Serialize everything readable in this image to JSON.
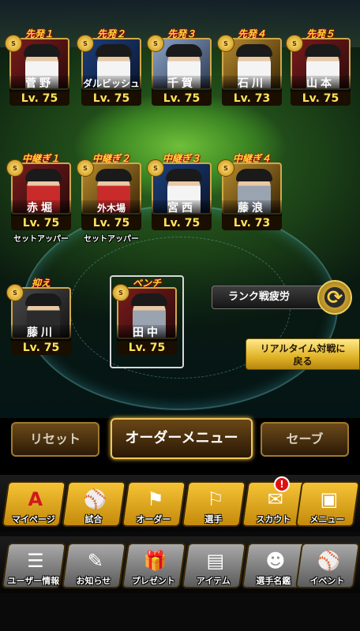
{
  "starters": [
    {
      "pos": "先発１",
      "name": "菅野",
      "lv": "Lv. 75",
      "badge": "S"
    },
    {
      "pos": "先発２",
      "name": "ダルビッシュ",
      "lv": "Lv. 75",
      "badge": "S"
    },
    {
      "pos": "先発３",
      "name": "千賀",
      "lv": "Lv. 75",
      "badge": "S"
    },
    {
      "pos": "先発４",
      "name": "石川",
      "lv": "Lv. 73",
      "badge": "S"
    },
    {
      "pos": "先発５",
      "name": "山本",
      "lv": "Lv. 75",
      "badge": "S"
    }
  ],
  "relievers": [
    {
      "pos": "中継ぎ１",
      "name": "赤堀",
      "lv": "Lv. 75",
      "sub": "セットアッパー",
      "badge": "S"
    },
    {
      "pos": "中継ぎ２",
      "name": "外木場",
      "lv": "Lv. 75",
      "sub": "セットアッパー",
      "badge": "S"
    },
    {
      "pos": "中継ぎ３",
      "name": "宮西",
      "lv": "Lv. 75",
      "sub": "",
      "badge": "S"
    },
    {
      "pos": "中継ぎ４",
      "name": "藤浪",
      "lv": "Lv. 73",
      "sub": "",
      "badge": "S"
    }
  ],
  "closer": {
    "pos": "抑え",
    "name": "藤川",
    "lv": "Lv. 75",
    "badge": "S"
  },
  "bench": {
    "pos": "ベンチ",
    "name": "田中",
    "lv": "Lv. 75",
    "badge": "S"
  },
  "rank_fatigue_label": "ランク戦疲労",
  "realtime_btn": {
    "line1": "リアルタイム対戦に",
    "line2": "戻る"
  },
  "order_buttons": {
    "reset": "リセット",
    "menu": "オーダーメニュー",
    "save": "セーブ"
  },
  "nav_row1": [
    {
      "label": "マイページ",
      "icon": "A"
    },
    {
      "label": "試合",
      "icon": "⚾"
    },
    {
      "label": "オーダー",
      "icon": "⚑"
    },
    {
      "label": "選手",
      "icon": "⚐"
    },
    {
      "label": "スカウト",
      "icon": "✉"
    },
    {
      "label": "メニュー",
      "icon": "▣"
    }
  ],
  "scout_notification": "!",
  "nav_row2": [
    {
      "label": "ユーザー情報",
      "icon": "☰"
    },
    {
      "label": "お知らせ",
      "icon": "✎"
    },
    {
      "label": "プレゼント",
      "icon": "🎁"
    },
    {
      "label": "アイテム",
      "icon": "▤"
    },
    {
      "label": "選手名鑑",
      "icon": "☻"
    },
    {
      "label": "イベント",
      "icon": "⚾"
    }
  ],
  "colors": {
    "gold": "#f6c335",
    "accent_text": "#ffe45a",
    "position_label": "#ffd63a"
  }
}
